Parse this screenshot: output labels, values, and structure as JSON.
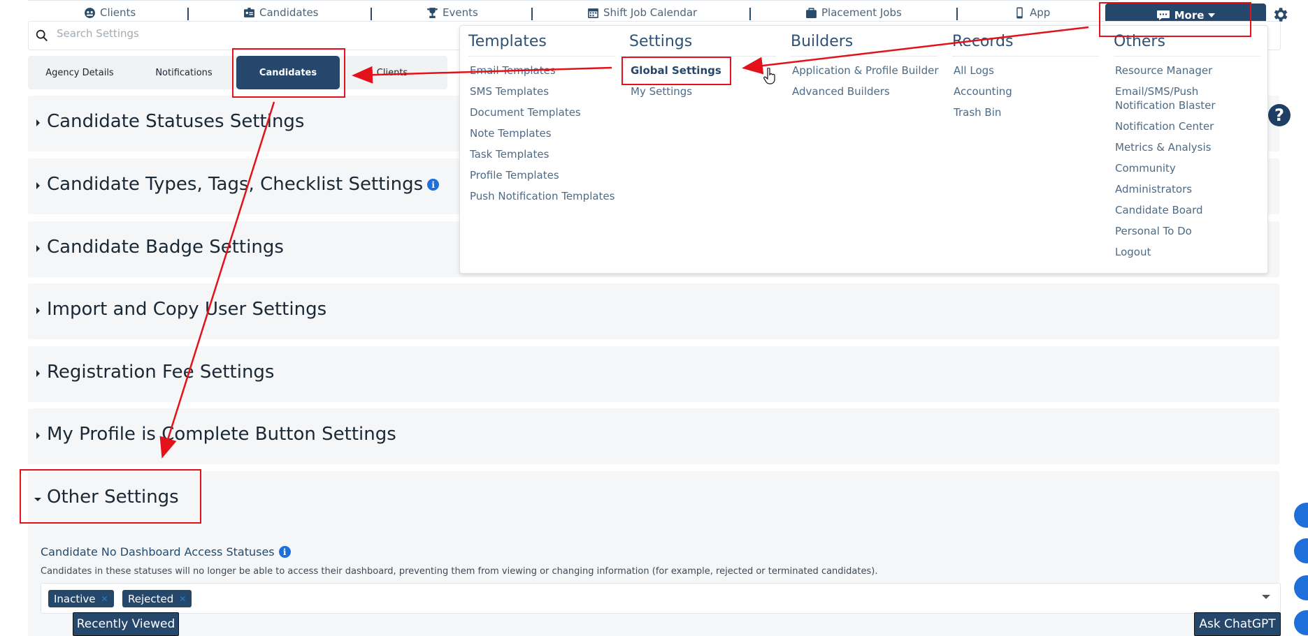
{
  "nav": {
    "items": [
      {
        "label": "Clients",
        "icon": "clients-icon"
      },
      {
        "label": "Candidates",
        "icon": "id-card-icon"
      },
      {
        "label": "Events",
        "icon": "trophy-icon"
      },
      {
        "label": "Shift Job Calendar",
        "icon": "calendar-icon"
      },
      {
        "label": "Placement Jobs",
        "icon": "briefcase-icon"
      },
      {
        "label": "App",
        "icon": "mobile-icon"
      }
    ],
    "more_label": "More"
  },
  "search": {
    "placeholder": "Search Settings"
  },
  "tabs": [
    {
      "label": "Agency Details"
    },
    {
      "label": "Notifications"
    },
    {
      "label": "Candidates",
      "active": true
    },
    {
      "label": "Clients"
    }
  ],
  "sections": [
    {
      "title": "Candidate Statuses Settings"
    },
    {
      "title": "Candidate Types, Tags, Checklist Settings"
    },
    {
      "title": "Candidate Badge Settings"
    },
    {
      "title": "Import and Copy User Settings"
    },
    {
      "title": "Registration Fee Settings"
    },
    {
      "title": "My Profile is Complete Button Settings"
    },
    {
      "title": "Other Settings"
    }
  ],
  "other_settings": {
    "field_label": "Candidate No Dashboard Access Statuses",
    "field_desc": "Candidates in these statuses will no longer be able to access their dashboard, preventing them from viewing or changing information (for example, rejected or terminated candidates).",
    "chips": [
      "Inactive",
      "Rejected"
    ]
  },
  "menu": {
    "templates": {
      "heading": "Templates",
      "items": [
        "Email Templates",
        "SMS Templates",
        "Document Templates",
        "Note Templates",
        "Task Templates",
        "Profile Templates",
        "Push Notification Templates"
      ]
    },
    "settings": {
      "heading": "Settings",
      "items": [
        "Global Settings",
        "My Settings"
      ]
    },
    "builders": {
      "heading": "Builders",
      "items": [
        "Application & Profile Builder",
        "Advanced Builders"
      ]
    },
    "records": {
      "heading": "Records",
      "items": [
        "All Logs",
        "Accounting",
        "Trash Bin"
      ]
    },
    "others": {
      "heading": "Others",
      "items": [
        "Resource Manager",
        "Email/SMS/Push Notification Blaster",
        "Notification Center",
        "Metrics & Analysis",
        "Community",
        "Administrators",
        "Candidate Board",
        "Personal To Do",
        "Logout"
      ]
    }
  },
  "buttons": {
    "recently_viewed": "Recently Viewed",
    "ask_chatgpt": "Ask ChatGPT",
    "help": "?"
  },
  "colors": {
    "primary": "#25476c",
    "annotation": "#e3121a",
    "info": "#1e6fd9"
  }
}
